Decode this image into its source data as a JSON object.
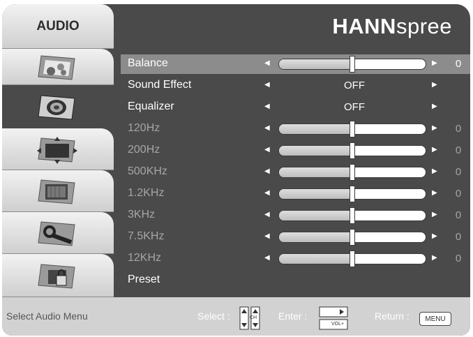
{
  "brand": {
    "bold": "HANN",
    "light": "spree"
  },
  "sidebar": {
    "title": "AUDIO",
    "tabs": [
      {
        "icon": "picture-settings-icon",
        "active": false
      },
      {
        "icon": "speaker-icon",
        "active": true
      },
      {
        "icon": "screen-position-icon",
        "active": false
      },
      {
        "icon": "pc-monitor-icon",
        "active": false
      },
      {
        "icon": "wrench-setup-icon",
        "active": false
      },
      {
        "icon": "parental-lock-icon",
        "active": false
      }
    ]
  },
  "menu": {
    "rows": [
      {
        "label": "Balance",
        "type": "slider",
        "value": "0",
        "level": 0.5,
        "selected": true,
        "dim": false
      },
      {
        "label": "Sound Effect",
        "type": "option",
        "value": "OFF",
        "selected": false,
        "dim": false
      },
      {
        "label": "Equalizer",
        "type": "option",
        "value": "OFF",
        "selected": false,
        "dim": false
      },
      {
        "label": "120Hz",
        "type": "slider",
        "value": "0",
        "level": 0.5,
        "selected": false,
        "dim": true
      },
      {
        "label": "200Hz",
        "type": "slider",
        "value": "0",
        "level": 0.5,
        "selected": false,
        "dim": true
      },
      {
        "label": "500KHz",
        "type": "slider",
        "value": "0",
        "level": 0.5,
        "selected": false,
        "dim": true
      },
      {
        "label": "1.2KHz",
        "type": "slider",
        "value": "0",
        "level": 0.5,
        "selected": false,
        "dim": true
      },
      {
        "label": "3KHz",
        "type": "slider",
        "value": "0",
        "level": 0.5,
        "selected": false,
        "dim": true
      },
      {
        "label": "7.5KHz",
        "type": "slider",
        "value": "0",
        "level": 0.5,
        "selected": false,
        "dim": true
      },
      {
        "label": "12KHz",
        "type": "slider",
        "value": "0",
        "level": 0.5,
        "selected": false,
        "dim": true
      },
      {
        "label": "Preset",
        "type": "action",
        "value": "",
        "selected": false,
        "dim": false
      }
    ]
  },
  "footer": {
    "hint": "Select Audio Menu",
    "select_label": "Select :",
    "ch_key": "CH",
    "enter_label": "Enter :",
    "vol_key": "VOL+",
    "return_label": "Return :",
    "menu_key": "MENU"
  }
}
